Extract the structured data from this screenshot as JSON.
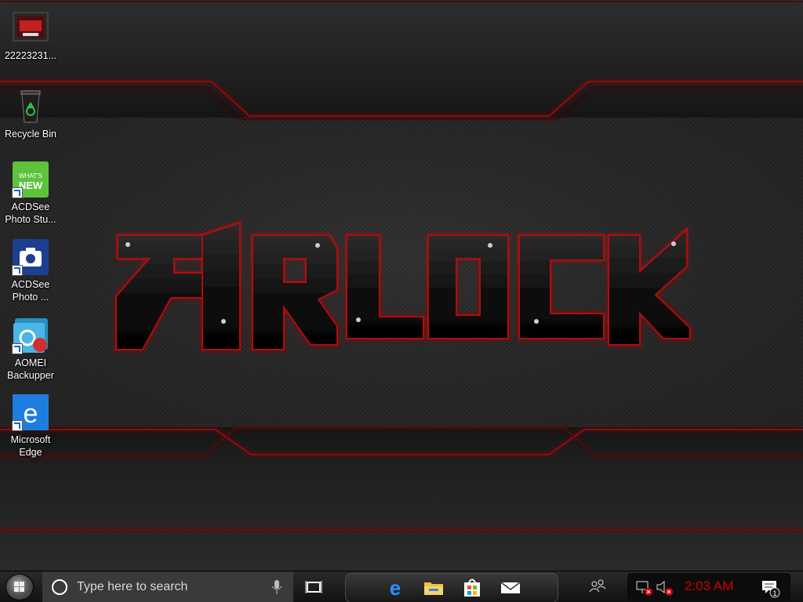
{
  "desktop": {
    "wallpaper_text": "AIRLOCK",
    "icons": [
      {
        "name": "folder-22223231",
        "label": "22223231...",
        "icon": "image-thumbnail-icon"
      },
      {
        "name": "recycle-bin",
        "label": "Recycle Bin",
        "icon": "recycle-bin-icon"
      },
      {
        "name": "acdsee-photo-studio",
        "label": "ACDSee Photo Stu...",
        "icon": "acdsee-whats-new-icon"
      },
      {
        "name": "acdsee-photo",
        "label": "ACDSee Photo ...",
        "icon": "acdsee-camera-icon"
      },
      {
        "name": "aomei-backupper",
        "label": "AOMEI Backupper",
        "icon": "aomei-backupper-icon"
      },
      {
        "name": "microsoft-edge",
        "label": "Microsoft Edge",
        "icon": "edge-icon"
      }
    ]
  },
  "taskbar": {
    "search_placeholder": "Type here to search",
    "pinned": [
      "edge-icon",
      "file-explorer-icon",
      "store-icon",
      "mail-icon"
    ],
    "clock": "2:03 AM",
    "notification_count": "1"
  },
  "colors": {
    "accent_red": "#d00000",
    "taskbar_bg": "#111111",
    "search_bg": "#3a3a3a"
  }
}
